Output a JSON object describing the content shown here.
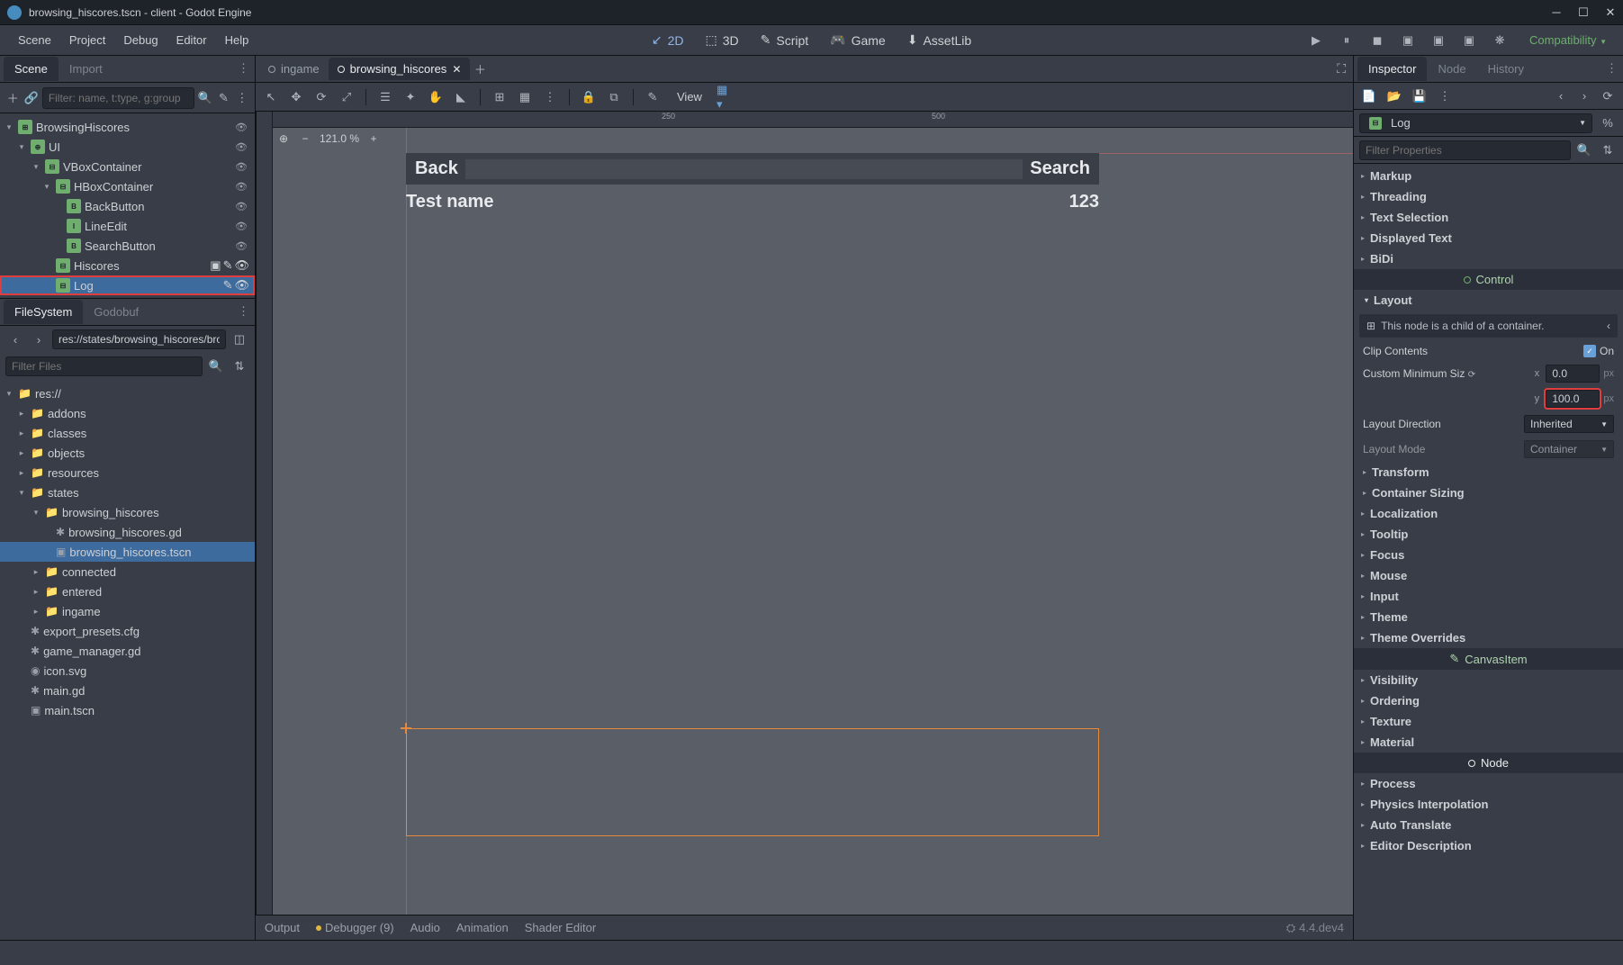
{
  "window": {
    "title": "browsing_hiscores.tscn - client - Godot Engine"
  },
  "menubar": {
    "items": [
      "Scene",
      "Project",
      "Debug",
      "Editor",
      "Help"
    ],
    "center": {
      "d2": "2D",
      "d3": "3D",
      "script": "Script",
      "game": "Game",
      "assetlib": "AssetLib"
    },
    "compat": "Compatibility"
  },
  "left": {
    "tabs": {
      "scene": "Scene",
      "import": "Import"
    },
    "filter_placeholder": "Filter: name, t:type, g:group",
    "tree": {
      "root": "BrowsingHiscores",
      "ui": "UI",
      "vbox": "VBoxContainer",
      "hbox": "HBoxContainer",
      "back": "BackButton",
      "lineedit": "LineEdit",
      "search": "SearchButton",
      "hiscores": "Hiscores",
      "log": "Log"
    },
    "fs_tabs": {
      "filesystem": "FileSystem",
      "godobuf": "Godobuf"
    },
    "path": "res://states/browsing_hiscores/browsi",
    "filter_files_placeholder": "Filter Files",
    "fs": {
      "root": "res://",
      "addons": "addons",
      "classes": "classes",
      "objects": "objects",
      "resources": "resources",
      "states": "states",
      "browsing_hiscores": "browsing_hiscores",
      "bh_gd": "browsing_hiscores.gd",
      "bh_tscn": "browsing_hiscores.tscn",
      "connected": "connected",
      "entered": "entered",
      "ingame": "ingame",
      "export_presets": "export_presets.cfg",
      "game_manager": "game_manager.gd",
      "icon": "icon.svg",
      "main_gd": "main.gd",
      "main_tscn": "main.tscn"
    }
  },
  "center": {
    "tabs": {
      "ingame": "ingame",
      "bh": "browsing_hiscores"
    },
    "zoom": "121.0 %",
    "toolbar": {
      "view": "View"
    },
    "ruler_ticks_h": [
      "250",
      "500"
    ],
    "mock": {
      "back": "Back",
      "search": "Search",
      "testname": "Test name",
      "num": "123"
    }
  },
  "bottom": {
    "output": "Output",
    "debugger": "Debugger (9)",
    "audio": "Audio",
    "animation": "Animation",
    "shader": "Shader Editor",
    "version": "4.4.dev4"
  },
  "inspector": {
    "tabs": {
      "inspector": "Inspector",
      "node": "Node",
      "history": "History"
    },
    "obj": "Log",
    "filter_placeholder": "Filter Properties",
    "sections": {
      "markup": "Markup",
      "threading": "Threading",
      "textselection": "Text Selection",
      "displayedtext": "Displayed Text",
      "bidi": "BiDi",
      "control": "Control",
      "layout": "Layout",
      "info": "This node is a child of a container.",
      "clip": "Clip Contents",
      "clip_on": "On",
      "minsize": "Custom Minimum Siz",
      "minsize_x": "0.0",
      "minsize_y": "100.0",
      "px": "px",
      "layoutdir": "Layout Direction",
      "layoutdir_val": "Inherited",
      "layoutmode": "Layout Mode",
      "layoutmode_val": "Container",
      "transform": "Transform",
      "containersizing": "Container Sizing",
      "localization": "Localization",
      "tooltip": "Tooltip",
      "focus": "Focus",
      "mouse": "Mouse",
      "input": "Input",
      "theme": "Theme",
      "themeoverrides": "Theme Overrides",
      "canvasitem": "CanvasItem",
      "visibility": "Visibility",
      "ordering": "Ordering",
      "texture": "Texture",
      "material": "Material",
      "node": "Node",
      "process": "Process",
      "physicsinterp": "Physics Interpolation",
      "autotranslate": "Auto Translate",
      "editordesc": "Editor Description"
    }
  }
}
